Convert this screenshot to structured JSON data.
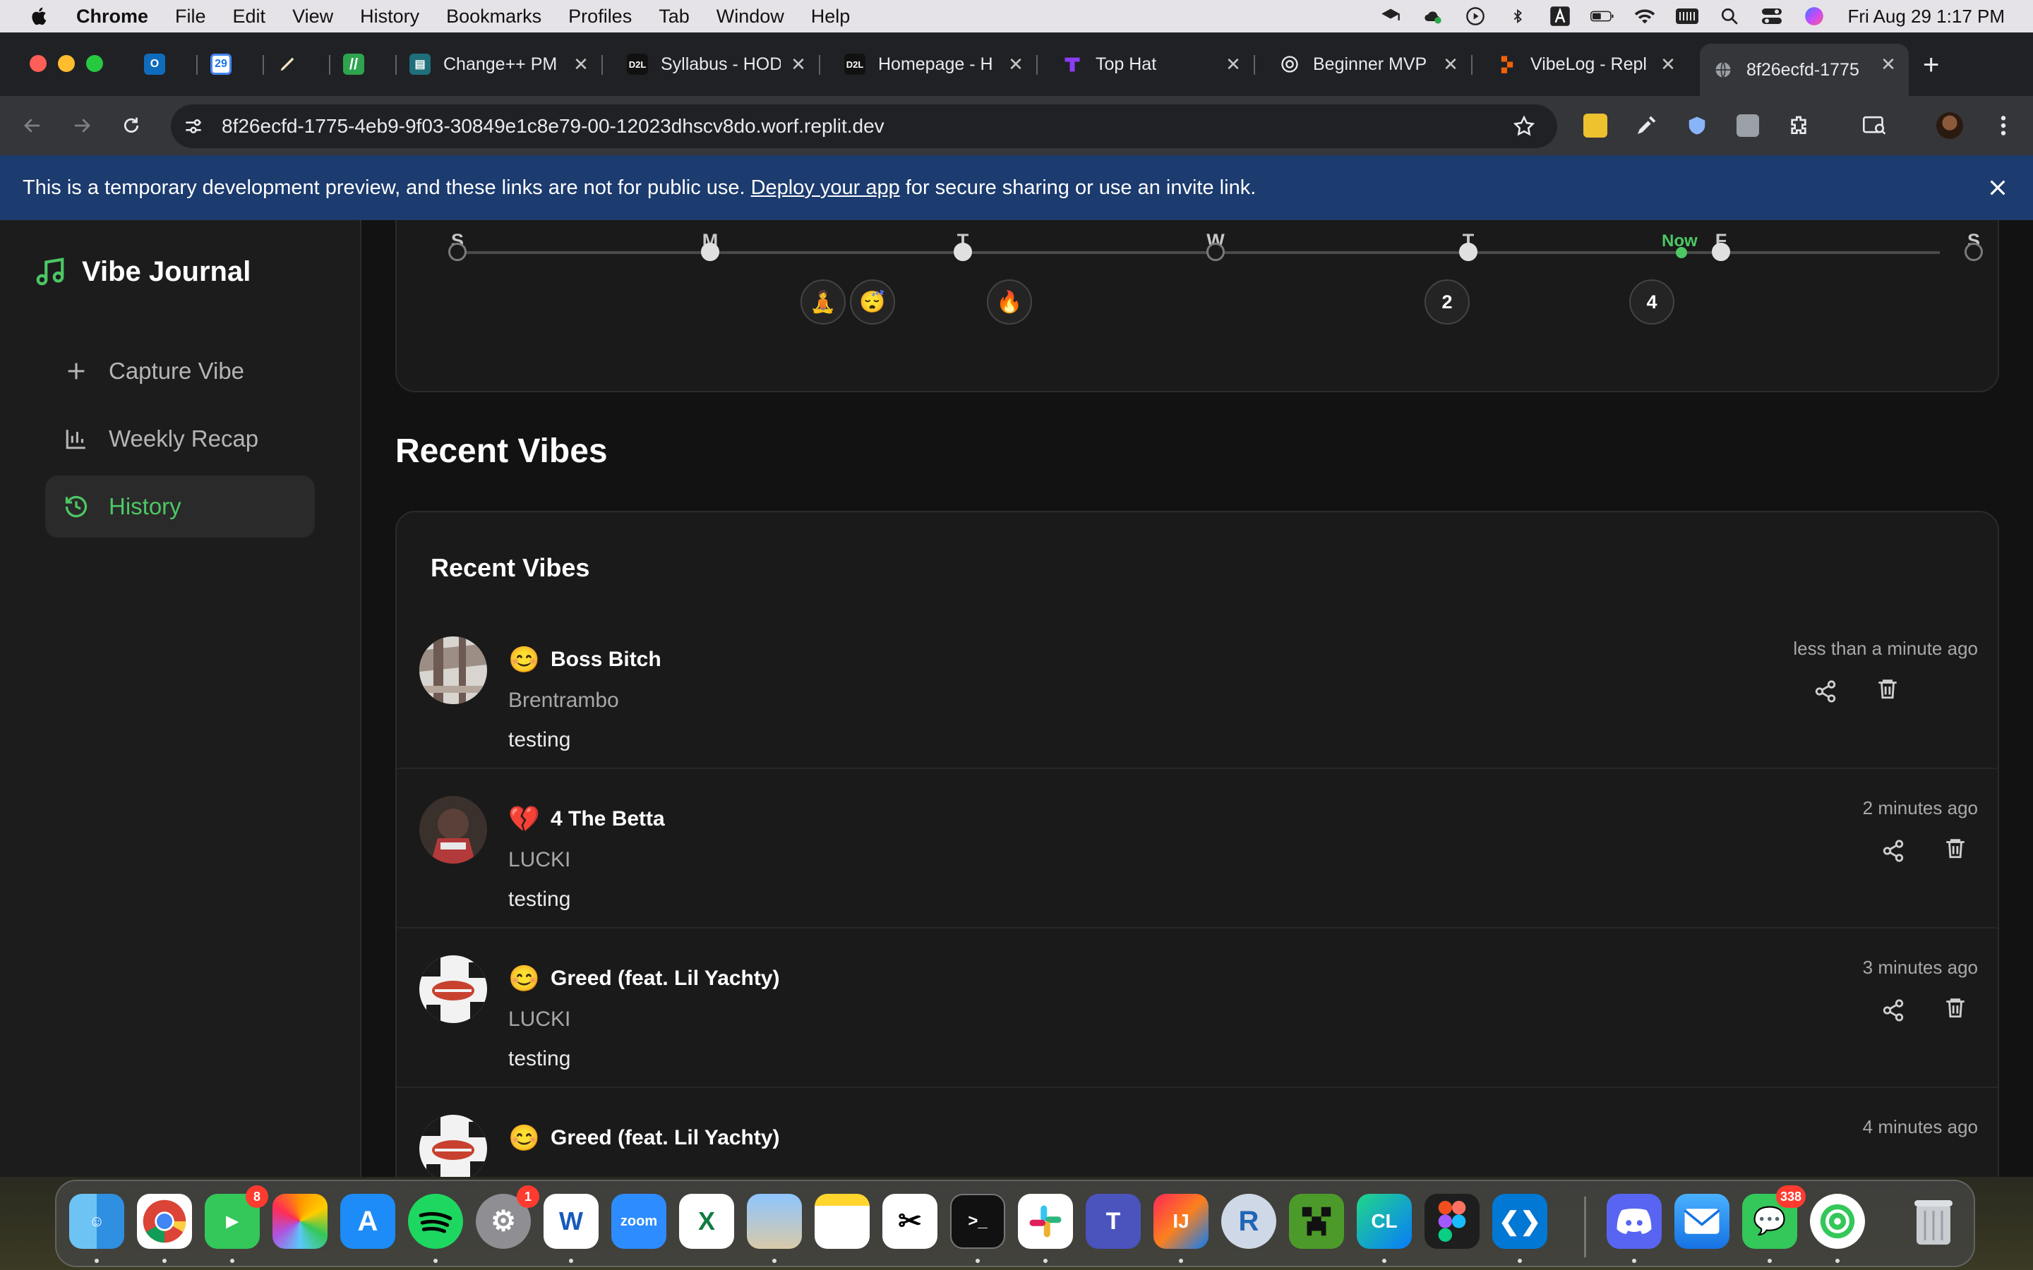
{
  "menubar": {
    "menus": [
      "Chrome",
      "File",
      "Edit",
      "View",
      "History",
      "Bookmarks",
      "Profiles",
      "Tab",
      "Window",
      "Help"
    ],
    "clock": "Fri Aug 29  1:17 PM"
  },
  "tabs": [
    {
      "title": "",
      "icon": "outlook-icon"
    },
    {
      "title": "",
      "icon": "calendar-icon",
      "badge": "29"
    },
    {
      "title": "",
      "icon": "pen-icon"
    },
    {
      "title": "",
      "icon": "slash-icon"
    },
    {
      "title": "Change++ PM",
      "icon": "doc-icon"
    },
    {
      "title": "Syllabus - HOD",
      "icon": "d2l-icon"
    },
    {
      "title": "Homepage - H",
      "icon": "d2l-icon"
    },
    {
      "title": "Top Hat",
      "icon": "tophat-icon"
    },
    {
      "title": "Beginner MVP",
      "icon": "openai-icon"
    },
    {
      "title": "VibeLog - Repl",
      "icon": "replit-icon"
    },
    {
      "title": "8f26ecfd-1775",
      "icon": "globe-icon"
    }
  ],
  "browser": {
    "url": "8f26ecfd-1775-4eb9-9f03-30849e1c8e79-00-12023dhscv8do.worf.replit.dev"
  },
  "banner": {
    "text_before": "This is a temporary development preview, and these links are not for public use.",
    "link": "Deploy your app",
    "text_after": "for secure sharing or use an invite link."
  },
  "sidebar": {
    "brand": "Vibe Journal",
    "items": [
      {
        "label": "Capture Vibe",
        "icon": "plus-icon"
      },
      {
        "label": "Weekly Recap",
        "icon": "bar-chart-icon"
      },
      {
        "label": "History",
        "icon": "history-icon",
        "active": true
      }
    ]
  },
  "timeline": {
    "days": [
      "S",
      "M",
      "T",
      "W",
      "T",
      "F",
      "S"
    ],
    "filled": [
      false,
      true,
      true,
      false,
      true,
      true,
      false
    ],
    "now_label": "Now",
    "bubbles": [
      "🧘",
      "😴",
      "🔥",
      "2",
      "4"
    ]
  },
  "recent": {
    "section_title": "Recent Vibes",
    "card_title": "Recent Vibes",
    "items": [
      {
        "emoji": "😊",
        "song": "Boss Bitch",
        "artist": "Brentrambo",
        "note": "testing",
        "time": "less than a minute ago"
      },
      {
        "emoji": "💔",
        "song": "4 The Betta",
        "artist": "LUCKI",
        "note": "testing",
        "time": "2 minutes ago"
      },
      {
        "emoji": "😊",
        "song": "Greed (feat. Lil Yachty)",
        "artist": "LUCKI",
        "note": "testing",
        "time": "3 minutes ago"
      },
      {
        "emoji": "😊",
        "song": "Greed (feat. Lil Yachty)",
        "artist": "",
        "note": "",
        "time": "4 minutes ago"
      }
    ]
  },
  "dock": {
    "facetime_badge": "8",
    "settings_badge": "1",
    "messages_badge": "338",
    "zoom_label": "zoom"
  }
}
